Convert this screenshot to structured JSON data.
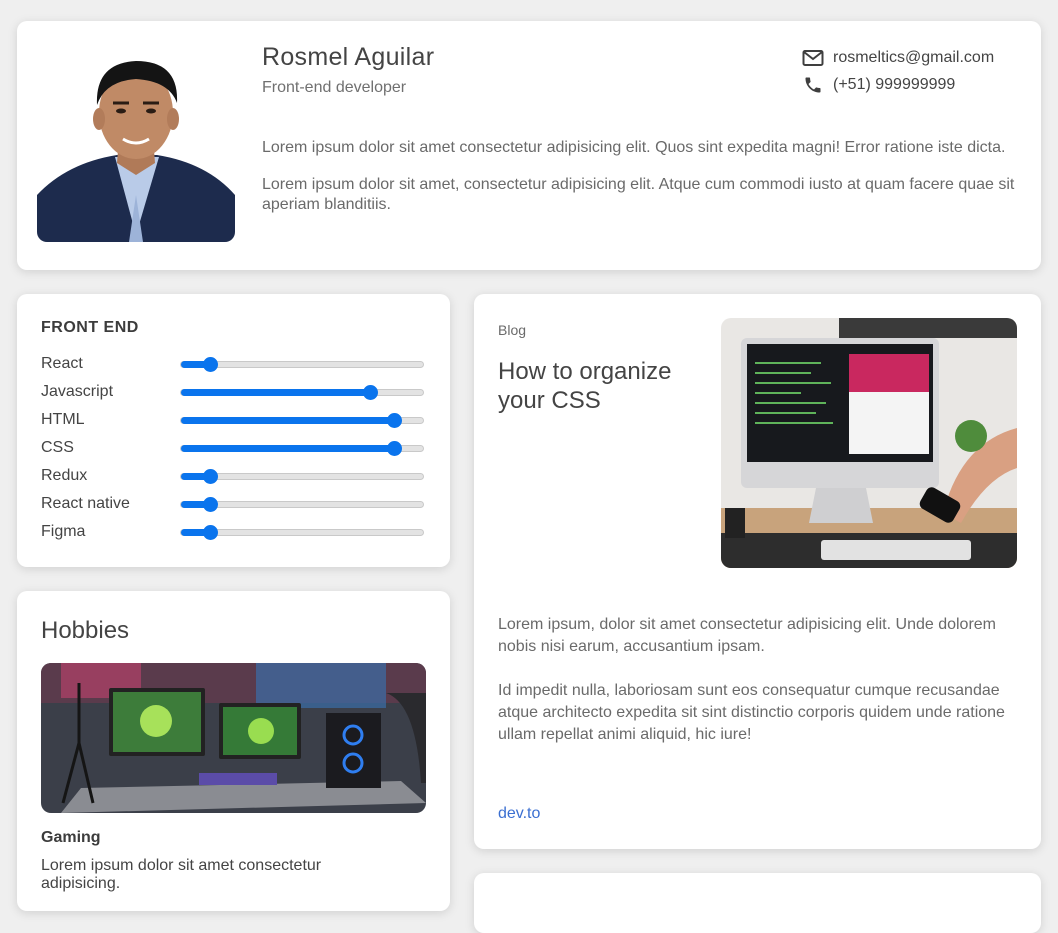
{
  "profile": {
    "name": "Rosmel Aguilar",
    "role": "Front-end developer",
    "email": "rosmeltics@gmail.com",
    "phone": "(+51) 999999999",
    "bio": [
      "Lorem ipsum dolor sit amet consectetur adipisicing elit. Quos sint expedita magni! Error ratione iste dicta.",
      "Lorem ipsum dolor sit amet, consectetur adipisicing elit. Atque cum commodi iusto at quam facere quae sit aperiam blanditiis."
    ],
    "icons": {
      "email": "mail-icon",
      "phone": "phone-icon"
    }
  },
  "skills": {
    "title": "FRONT END",
    "accent_color": "#0a74ed",
    "items": [
      {
        "label": "React",
        "level": 0.12
      },
      {
        "label": "Javascript",
        "level": 0.78
      },
      {
        "label": "HTML",
        "level": 0.88
      },
      {
        "label": "CSS",
        "level": 0.88
      },
      {
        "label": "Redux",
        "level": 0.12
      },
      {
        "label": "React native",
        "level": 0.12
      },
      {
        "label": "Figma",
        "level": 0.12
      }
    ]
  },
  "hobbies": {
    "title": "Hobbies",
    "items": [
      {
        "name": "Gaming",
        "description": "Lorem ipsum dolor sit amet consectetur adipisicing."
      }
    ]
  },
  "blog": {
    "tag": "Blog",
    "title": "How to organize your CSS",
    "paragraphs": [
      "Lorem ipsum, dolor sit amet consectetur adipisicing elit. Unde dolorem nobis nisi earum, accusantium ipsam.",
      "Id impedit nulla, laboriosam sunt eos consequatur cumque recusandae atque architecto expedita sit sint distinctio corporis quidem unde ratione ullam repellat animi aliquid, hic iure!"
    ],
    "link_text": "dev.to",
    "link_color": "#3b6fd1"
  }
}
